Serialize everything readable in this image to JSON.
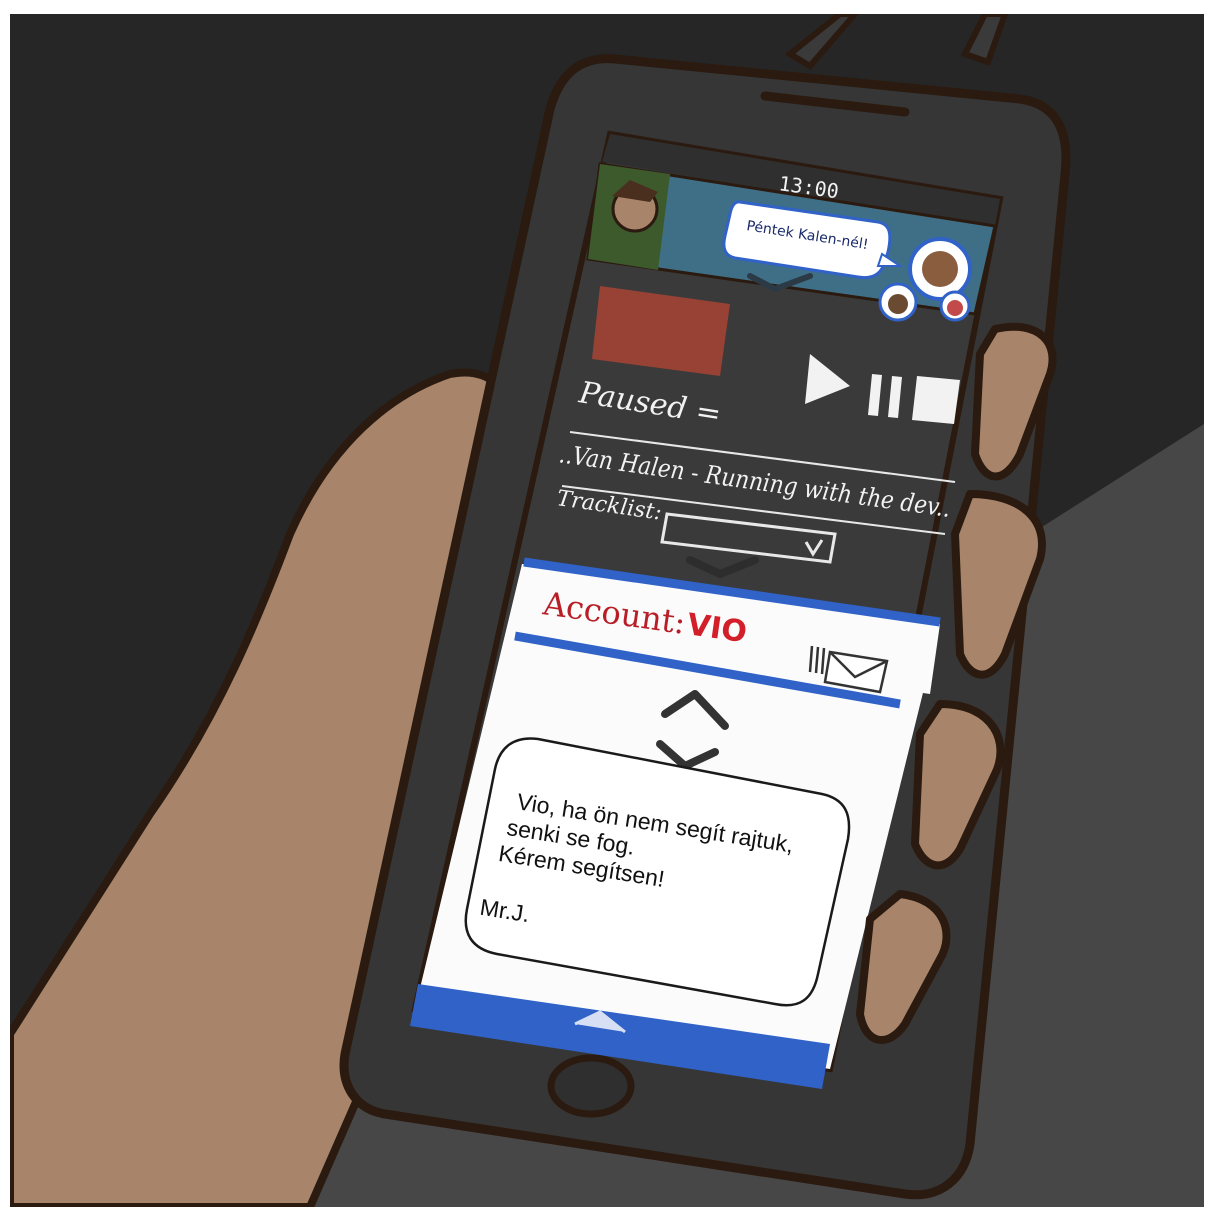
{
  "status_bar": {
    "time": "13:00"
  },
  "video_banner": {
    "speech_bubble": "Péntek Kalen-nél!"
  },
  "player": {
    "state_label": "Paused =",
    "track_title": "..Van Halen - Running with the dev..",
    "tracklist_label": "Tracklist:"
  },
  "account": {
    "label": "Account:",
    "name": "VIO"
  },
  "message": {
    "lines": [
      "Vio, ha ön nem segít rajtuk,",
      "senki se fog.",
      "Kérem segítsen!"
    ],
    "signature": "Mr.J."
  },
  "colors": {
    "background": "#262626",
    "skin": "#a8856a",
    "phone_body": "#363636",
    "banner_blue": "#3f6f86",
    "album_art": "#974234",
    "accent_blue": "#3062c8",
    "account_red": "#d21f2a"
  }
}
